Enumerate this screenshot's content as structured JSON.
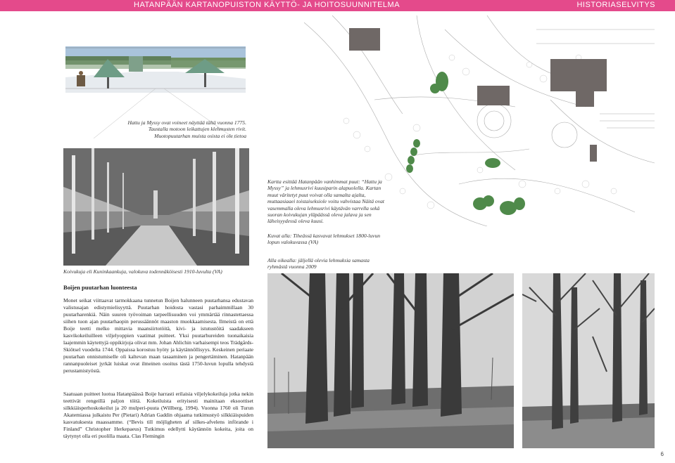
{
  "header": {
    "title": "HATANPÄÄN KARTANOPUISTON KÄYTTÖ- JA HOITOSUUNNITELMA",
    "section": "HISTORIASELVITYS"
  },
  "sketch": {
    "caption": "Hattu ja Myssy ovat voineet näyttää tältä vuonna 1775. Taustalla motoon leikattujen klehmusten rivit. Muotopuutarhan muista osista ei ole tietoa"
  },
  "avenue_photo": {
    "caption": "Koivukuja eli Kuninkaankuja, valokuva todennäköisesti 1910-luvulta (VA)"
  },
  "map": {
    "caption": "Kartta esittää Hatanpään vanhimmat puut: “Hattu ja Myssy” ja lehmusrivi kuusiparin alapuolella. Kartan muut väritetyt puut voivat olla samalta ajalta, muttaasiaaei toistaiseksiole voitu vahvistaa Näitä ovat vasemmalla oleva lehmusrivi käytävän varrella sekä suoran koivukujan yläpäässä oleva jalava ja sen läheisyydessä oleva kuusi."
  },
  "lime_photo": {
    "caption": "Kuvat alla: Tiheässä kasvavat lehmukset 1800-luvun lopun valokuvassa (VA)"
  },
  "remaining_photo": {
    "caption": "Alla oikealla: jäljellä olevia lehmuksia samasta ryhmästä vuonna 2009"
  },
  "article": {
    "heading": "Boijen puutarhan luonteesta",
    "paragraph1": "Monet seikat viittaavat tarmokkaana tunnetun Boijen halunneen puutarhansa edustavan valistusajan edistymielisyyttä. Puutarhan hoidosta vastasi parhaimmillaan 30 puutarharenkiä. Näin suuren työvoiman tarpeellisuuden voi ymmärtää rinnastettaessa siihen tuon ajan puutarhaopin perussäännöt maaston muokkaamisesta. Ilmeistä on että Boije teetti melko mittavia maansiirtotöitä, kivi- ja istutustöitä saadakseen kasvikokeiluilleen viljelyoppien vaatimat puitteet. Yksi puutarhureiden tuonaikaisia laajemmin käytettyjä oppikirjoja olivat mm. Johan Ahlichin varhaisempi teos Trädgårds-Skiötsel vuodelta 1744. Oppaissa korostuu hyöty ja käytännöllisyys. Keskeinen periaate puutarhan onnistumiselle oli kaltevan maan tasaaminen ja pengertäminen. Hatanpään rannanpuoleiset jyrkät luiskat ovat ilmeinen osoitus tästä 1750-luvun lopulla tehdystä perustamistyöstä.",
    "paragraph2": "Saatuaan puitteet luotua Hatanpäässä Boije harrasti erilaisia viljelykokeiluja jotka nekin teettivät rengeillä paljon töitä. Kokeiluista erityisesti mainitaan eksoottiset silkkiäisperhoskokeilut ja 20 mulperi-puuta (Willberg, 1994). Vuonna 1760 oli Turun Akatemiassa julkaistu Per (Pietari) Adrian Gaddin ohjaama tutkimustyö silkkiäispuiden kasvatuksesta maassamme. (“Bevis till möjligheten af silkes-afvelens införande i Finland” Christopher Herkepaeus) Tutkimus edellytti käytännön kokeita, joita on täytynyt olla eri puolilla maata. Clas Flemingin"
  },
  "page_number": "6",
  "colors": {
    "header": "#e44a8b",
    "tree_highlight": "#4f8a4a",
    "building": "#6f6866"
  }
}
